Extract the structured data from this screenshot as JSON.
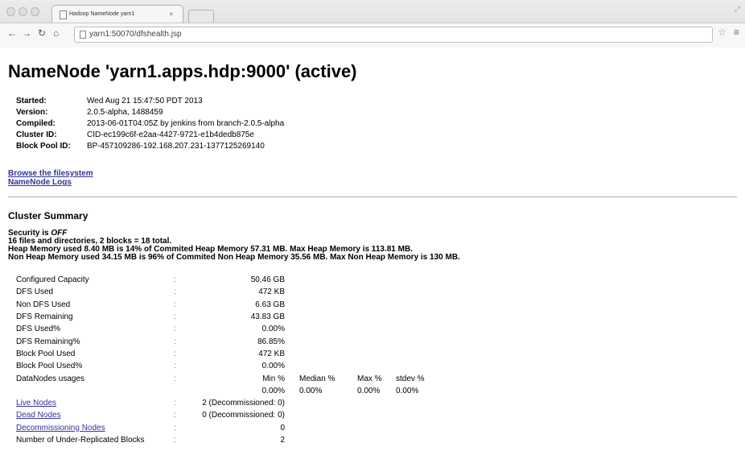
{
  "browser": {
    "tab_title": "Hadoop NameNode yarn1",
    "tab_close": "×",
    "url": "yarn1:50070/dfshealth.jsp"
  },
  "page": {
    "title": "NameNode 'yarn1.apps.hdp:9000' (active)",
    "info": [
      {
        "key": "Started:",
        "value": "Wed Aug 21 15:47:50 PDT 2013"
      },
      {
        "key": "Version:",
        "value": "2.0.5-alpha, 1488459"
      },
      {
        "key": "Compiled:",
        "value": "2013-06-01T04:05Z by jenkins from branch-2.0.5-alpha"
      },
      {
        "key": "Cluster ID:",
        "value": "CID-ec199c6f-e2aa-4427-9721-e1b4dedb875e"
      },
      {
        "key": "Block Pool ID:",
        "value": "BP-457109286-192.168.207.231-1377125269140"
      }
    ],
    "links": {
      "browse": "Browse the filesystem",
      "logs": "NameNode Logs"
    },
    "cluster_summary": {
      "heading": "Cluster Summary",
      "security_prefix": "Security is ",
      "security_state": "OFF",
      "files_line": "16 files and directories, 2 blocks = 18 total.",
      "heap_line": "Heap Memory used 8.40 MB is 14% of Commited Heap Memory 57.31 MB. Max Heap Memory is 113.81 MB.",
      "nonheap_line": "Non Heap Memory used 34.15 MB is 96% of Commited Non Heap Memory 35.56 MB. Max Non Heap Memory is 130 MB."
    },
    "summary_rows": [
      {
        "label": "Configured Capacity",
        "colon": ":",
        "value": "50.46 GB"
      },
      {
        "label": "DFS Used",
        "colon": ":",
        "value": "472 KB"
      },
      {
        "label": "Non DFS Used",
        "colon": ":",
        "value": "6.63 GB"
      },
      {
        "label": "DFS Remaining",
        "colon": ":",
        "value": "43.83 GB"
      },
      {
        "label": "DFS Used%",
        "colon": ":",
        "value": "0.00%"
      },
      {
        "label": "DFS Remaining%",
        "colon": ":",
        "value": "86.85%"
      },
      {
        "label": "Block Pool Used",
        "colon": ":",
        "value": "472 KB"
      },
      {
        "label": "Block Pool Used%",
        "colon": ":",
        "value": "0.00%"
      }
    ],
    "datanodes_usages": {
      "label": "DataNodes usages",
      "colon": ":",
      "headers": [
        "Min %",
        "Median %",
        "Max %",
        "stdev %"
      ],
      "values": [
        "0.00%",
        "0.00%",
        "0.00%",
        "0.00%"
      ]
    },
    "node_rows": [
      {
        "label": "Live Nodes",
        "colon": ":",
        "value": "2 (Decommissioned: 0)"
      },
      {
        "label": "Dead Nodes",
        "colon": ":",
        "value": "0 (Decommissioned: 0)"
      },
      {
        "label": "Decommissioning Nodes",
        "colon": ":",
        "value": "0"
      }
    ],
    "under_replicated": {
      "label": "Number of Under-Replicated Blocks",
      "colon": ":",
      "value": "2"
    }
  }
}
